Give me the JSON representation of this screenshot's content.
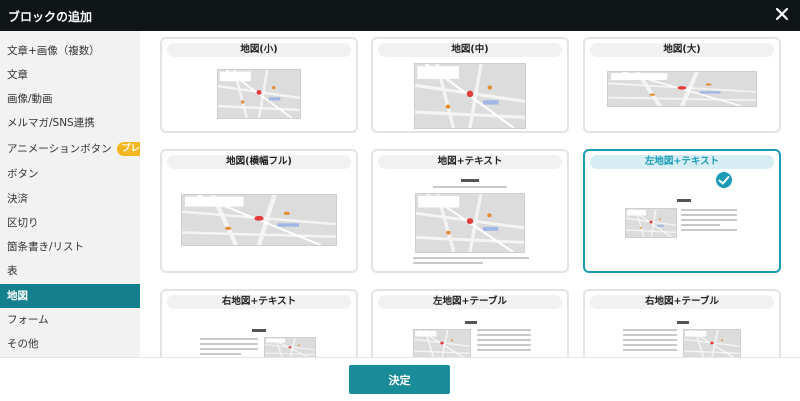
{
  "dialog": {
    "title": "ブロックの追加",
    "close_icon": "close-icon"
  },
  "sidebar": {
    "items": [
      {
        "label": "文章+画像（複数）"
      },
      {
        "label": "文章"
      },
      {
        "label": "画像/動画"
      },
      {
        "label": "メルマガ/SNS連携"
      },
      {
        "label": "アニメーションボタン",
        "badge": "プレミアム"
      },
      {
        "label": "ボタン"
      },
      {
        "label": "決済"
      },
      {
        "label": "区切り"
      },
      {
        "label": "箇条書き/リスト"
      },
      {
        "label": "表"
      },
      {
        "label": "地図",
        "active": true
      },
      {
        "label": "フォーム"
      },
      {
        "label": "その他"
      }
    ]
  },
  "cards": [
    {
      "title": "地図(小)"
    },
    {
      "title": "地図(中)"
    },
    {
      "title": "地図(大)"
    },
    {
      "title": "地図(横幅フル)"
    },
    {
      "title": "地図+テキスト"
    },
    {
      "title": "左地図+テキスト",
      "selected": true
    },
    {
      "title": "右地図+テキスト"
    },
    {
      "title": "左地図+テーブル"
    },
    {
      "title": "右地図+テーブル"
    }
  ],
  "footer": {
    "confirm_label": "決定"
  },
  "colors": {
    "accent": "#1a8b98",
    "selected_border": "#1a9bb5",
    "badge": "#f3b81f",
    "titlebar": "#0f1417"
  }
}
